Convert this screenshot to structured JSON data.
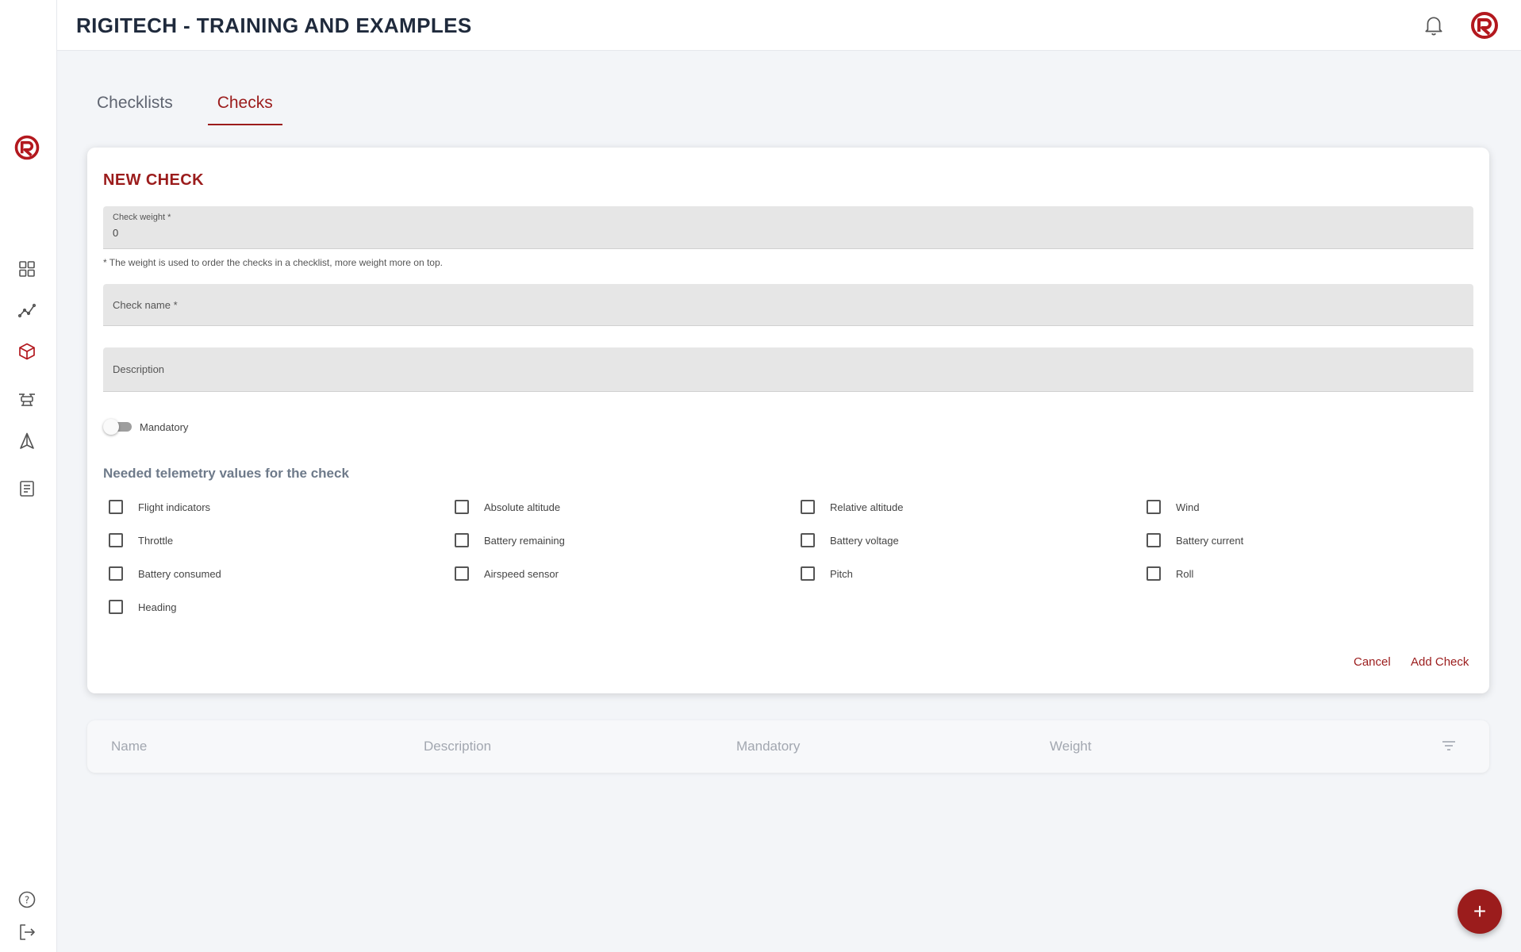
{
  "header": {
    "title": "RIGITECH - TRAINING AND EXAMPLES"
  },
  "tabs": [
    {
      "label": "Checklists",
      "active": false
    },
    {
      "label": "Checks",
      "active": true
    }
  ],
  "form": {
    "title": "NEW CHECK",
    "weight": {
      "label": "Check weight *",
      "value": "0"
    },
    "weight_hint": "* The weight is used to order the checks in a checklist, more weight more on top.",
    "name": {
      "placeholder": "Check name *"
    },
    "description": {
      "placeholder": "Description"
    },
    "mandatory": {
      "label": "Mandatory",
      "on": false
    },
    "telemetry_title": "Needed telemetry values for the check",
    "telemetry": [
      "Flight indicators",
      "Absolute altitude",
      "Relative altitude",
      "Wind",
      "Throttle",
      "Battery remaining",
      "Battery voltage",
      "Battery current",
      "Battery consumed",
      "Airspeed sensor",
      "Pitch",
      "Roll",
      "Heading"
    ],
    "cancel_label": "Cancel",
    "add_label": "Add Check"
  },
  "table": {
    "columns": [
      "Name",
      "Description",
      "Mandatory",
      "Weight"
    ]
  },
  "fab": {
    "label": "+"
  },
  "colors": {
    "accent": "#9b1c1c",
    "background": "#f3f5f8"
  }
}
